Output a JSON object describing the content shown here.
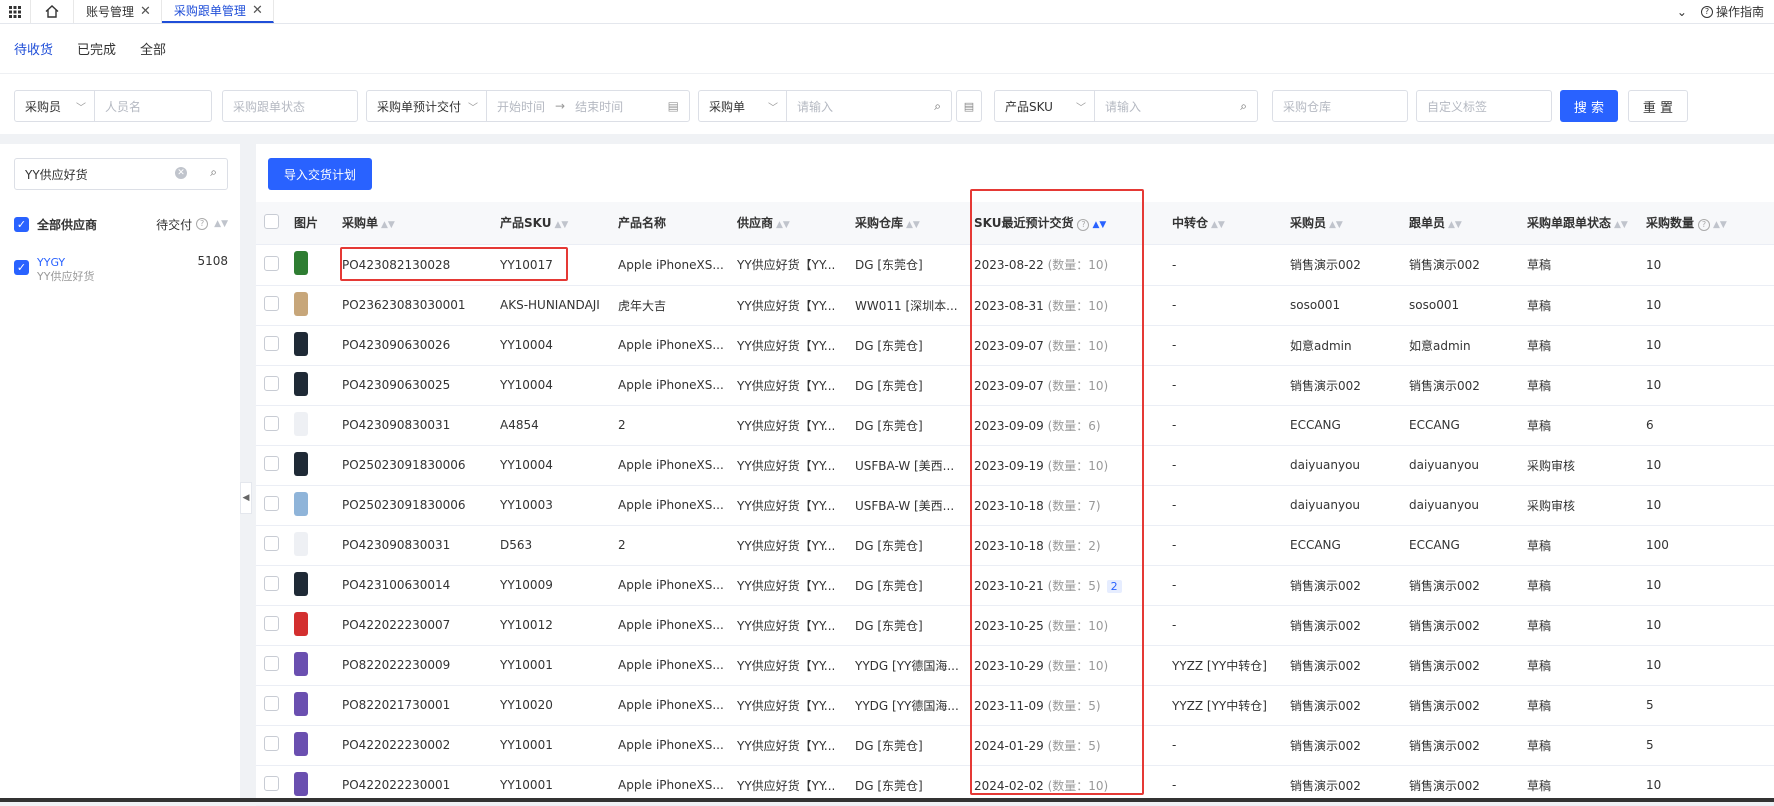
{
  "topbar": {
    "tabs": [
      {
        "label": "账号管理",
        "active": false
      },
      {
        "label": "采购跟单管理",
        "active": true
      }
    ],
    "help_label": "操作指南"
  },
  "status_tabs": [
    {
      "label": "待收货",
      "active": true
    },
    {
      "label": "已完成",
      "active": false
    },
    {
      "label": "全部",
      "active": false
    }
  ],
  "filters": {
    "buyer_select": "采购员",
    "buyer_placeholder": "人员名",
    "order_status_placeholder": "采购跟单状态",
    "date_select": "采购单预计交付",
    "start_placeholder": "开始时间",
    "end_placeholder": "结束时间",
    "order_select": "采购单",
    "order_placeholder": "请输入",
    "sku_select": "产品SKU",
    "sku_placeholder": "请输入",
    "warehouse_placeholder": "采购仓库",
    "tag_placeholder": "自定义标签",
    "search_label": "搜 索",
    "reset_label": "重 置"
  },
  "supplier_panel": {
    "search_value": "YY供应好货",
    "all_label": "全部供应商",
    "pending_label": "待交付",
    "suppliers": [
      {
        "code": "YYGY",
        "name": "YY供应好货",
        "count": "5108"
      }
    ]
  },
  "main": {
    "import_label": "导入交货计划",
    "columns": [
      "图片",
      "采购单",
      "产品SKU",
      "产品名称",
      "供应商",
      "采购仓库",
      "SKU最近预计交货",
      "中转仓",
      "采购员",
      "跟单员",
      "采购单跟单状态",
      "采购数量"
    ],
    "qty_prefix": "(数量：",
    "rows": [
      {
        "thumb": "#2e7d32",
        "po": "PO423082130028",
        "sku": "YY10017",
        "name": "Apple iPhoneXS...",
        "supplier": "YY供应好货【YY...",
        "warehouse": "DG [东莞仓]",
        "date": "2023-08-22",
        "qty": "10",
        "badge": "",
        "transit": "-",
        "buyer": "销售演示002",
        "follower": "销售演示002",
        "status": "草稿",
        "amount": "10"
      },
      {
        "thumb": "#c7a67a",
        "po": "PO23623083030001",
        "sku": "AKS-HUNIANDAJI",
        "name": "虎年大吉",
        "supplier": "YY供应好货【YY...",
        "warehouse": "WW011 [深圳本...",
        "date": "2023-08-31",
        "qty": "10",
        "badge": "",
        "transit": "-",
        "buyer": "soso001",
        "follower": "soso001",
        "status": "草稿",
        "amount": "10"
      },
      {
        "thumb": "#1f2a36",
        "po": "PO423090630026",
        "sku": "YY10004",
        "name": "Apple iPhoneXS...",
        "supplier": "YY供应好货【YY...",
        "warehouse": "DG [东莞仓]",
        "date": "2023-09-07",
        "qty": "10",
        "badge": "",
        "transit": "-",
        "buyer": "如意admin",
        "follower": "如意admin",
        "status": "草稿",
        "amount": "10"
      },
      {
        "thumb": "#1f2a36",
        "po": "PO423090630025",
        "sku": "YY10004",
        "name": "Apple iPhoneXS...",
        "supplier": "YY供应好货【YY...",
        "warehouse": "DG [东莞仓]",
        "date": "2023-09-07",
        "qty": "10",
        "badge": "",
        "transit": "-",
        "buyer": "销售演示002",
        "follower": "销售演示002",
        "status": "草稿",
        "amount": "10"
      },
      {
        "thumb": "#eef0f4",
        "po": "PO423090830031",
        "sku": "A4854",
        "name": "2",
        "supplier": "YY供应好货【YY...",
        "warehouse": "DG [东莞仓]",
        "date": "2023-09-09",
        "qty": "6",
        "badge": "",
        "transit": "-",
        "buyer": "ECCANG",
        "follower": "ECCANG",
        "status": "草稿",
        "amount": "6"
      },
      {
        "thumb": "#1f2a36",
        "po": "PO25023091830006",
        "sku": "YY10004",
        "name": "Apple iPhoneXS...",
        "supplier": "YY供应好货【YY...",
        "warehouse": "USFBA-W [美西...",
        "date": "2023-09-19",
        "qty": "10",
        "badge": "",
        "transit": "-",
        "buyer": "daiyuanyou",
        "follower": "daiyuanyou",
        "status": "采购审核",
        "amount": "10"
      },
      {
        "thumb": "#8fb4d9",
        "po": "PO25023091830006",
        "sku": "YY10003",
        "name": "Apple iPhoneXS...",
        "supplier": "YY供应好货【YY...",
        "warehouse": "USFBA-W [美西...",
        "date": "2023-10-18",
        "qty": "7",
        "badge": "",
        "transit": "-",
        "buyer": "daiyuanyou",
        "follower": "daiyuanyou",
        "status": "采购审核",
        "amount": "10"
      },
      {
        "thumb": "#eef0f4",
        "po": "PO423090830031",
        "sku": "D563",
        "name": "2",
        "supplier": "YY供应好货【YY...",
        "warehouse": "DG [东莞仓]",
        "date": "2023-10-18",
        "qty": "2",
        "badge": "",
        "transit": "-",
        "buyer": "ECCANG",
        "follower": "ECCANG",
        "status": "草稿",
        "amount": "100"
      },
      {
        "thumb": "#1f2a36",
        "po": "PO423100630014",
        "sku": "YY10009",
        "name": "Apple iPhoneXS...",
        "supplier": "YY供应好货【YY...",
        "warehouse": "DG [东莞仓]",
        "date": "2023-10-21",
        "qty": "5",
        "badge": "2",
        "transit": "-",
        "buyer": "销售演示002",
        "follower": "销售演示002",
        "status": "草稿",
        "amount": "10"
      },
      {
        "thumb": "#d32f2f",
        "po": "PO422022230007",
        "sku": "YY10012",
        "name": "Apple iPhoneXS...",
        "supplier": "YY供应好货【YY...",
        "warehouse": "DG [东莞仓]",
        "date": "2023-10-25",
        "qty": "10",
        "badge": "",
        "transit": "-",
        "buyer": "销售演示002",
        "follower": "销售演示002",
        "status": "草稿",
        "amount": "10"
      },
      {
        "thumb": "#6a4fb0",
        "po": "PO822022230009",
        "sku": "YY10001",
        "name": "Apple iPhoneXS...",
        "supplier": "YY供应好货【YY...",
        "warehouse": "YYDG [YY德国海...",
        "date": "2023-10-29",
        "qty": "10",
        "badge": "",
        "transit": "YYZZ [YY中转仓]",
        "buyer": "销售演示002",
        "follower": "销售演示002",
        "status": "草稿",
        "amount": "10"
      },
      {
        "thumb": "#6a4fb0",
        "po": "PO822021730001",
        "sku": "YY10020",
        "name": "Apple iPhoneXS...",
        "supplier": "YY供应好货【YY...",
        "warehouse": "YYDG [YY德国海...",
        "date": "2023-11-09",
        "qty": "5",
        "badge": "",
        "transit": "YYZZ [YY中转仓]",
        "buyer": "销售演示002",
        "follower": "销售演示002",
        "status": "草稿",
        "amount": "5"
      },
      {
        "thumb": "#6a4fb0",
        "po": "PO422022230002",
        "sku": "YY10001",
        "name": "Apple iPhoneXS...",
        "supplier": "YY供应好货【YY...",
        "warehouse": "DG [东莞仓]",
        "date": "2024-01-29",
        "qty": "5",
        "badge": "",
        "transit": "-",
        "buyer": "销售演示002",
        "follower": "销售演示002",
        "status": "草稿",
        "amount": "5"
      },
      {
        "thumb": "#6a4fb0",
        "po": "PO422022230001",
        "sku": "YY10001",
        "name": "Apple iPhoneXS...",
        "supplier": "YY供应好货【YY...",
        "warehouse": "DG [东莞仓]",
        "date": "2024-02-02",
        "qty": "10",
        "badge": "",
        "transit": "-",
        "buyer": "销售演示002",
        "follower": "销售演示002",
        "status": "草稿",
        "amount": "10"
      }
    ]
  }
}
